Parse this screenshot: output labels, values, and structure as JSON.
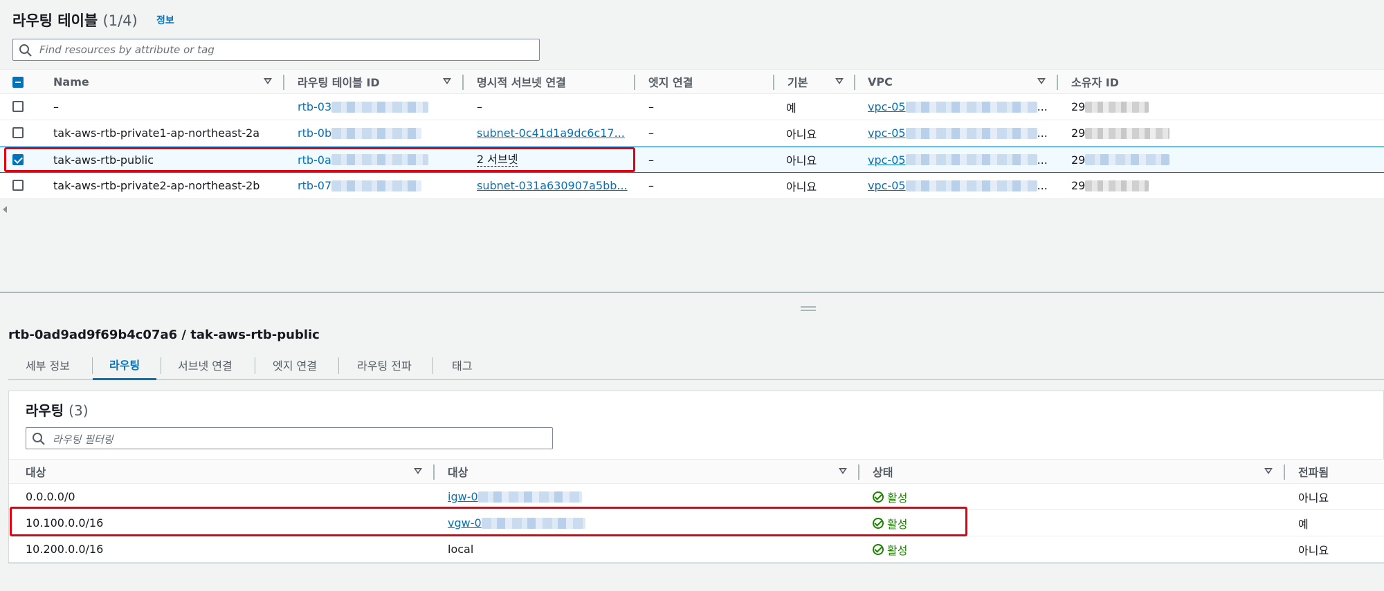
{
  "route_tables": {
    "title": "라우팅 테이블",
    "count": "(1/4)",
    "info_link": "정보",
    "search_placeholder": "Find resources by attribute or tag",
    "columns": [
      "Name",
      "라우팅 테이블 ID",
      "명시적 서브넷 연결",
      "엣지 연결",
      "기본",
      "VPC",
      "소유자 ID"
    ],
    "rows": [
      {
        "name": "–",
        "id_prefix": "rtb-03",
        "subnet": "–",
        "subnet_is_link": false,
        "edge": "–",
        "main": "예",
        "vpc_prefix": "vpc-05",
        "vpc_suffix": "...",
        "owner_prefix": "29",
        "selected": false
      },
      {
        "name": "tak-aws-rtb-private1-ap-northeast-2a",
        "id_prefix": "rtb-0b",
        "subnet": "subnet-0c41d1a9dc6c17...",
        "subnet_is_link": true,
        "edge": "–",
        "main": "아니요",
        "vpc_prefix": "vpc-05",
        "vpc_suffix": "...",
        "owner_prefix": "29",
        "selected": false
      },
      {
        "name": "tak-aws-rtb-public",
        "id_prefix": "rtb-0a",
        "subnet": "2 서브넷",
        "subnet_is_link": false,
        "edge": "–",
        "main": "아니요",
        "vpc_prefix": "vpc-05",
        "vpc_suffix": "...",
        "owner_prefix": "29",
        "selected": true
      },
      {
        "name": "tak-aws-rtb-private2-ap-northeast-2b",
        "id_prefix": "rtb-07",
        "subnet": "subnet-031a630907a5bb...",
        "subnet_is_link": true,
        "edge": "–",
        "main": "아니요",
        "vpc_prefix": "vpc-05",
        "vpc_suffix": "...",
        "owner_prefix": "29",
        "selected": false
      }
    ]
  },
  "detail": {
    "title": "rtb-0ad9ad9f69b4c07a6 / tak-aws-rtb-public",
    "tabs": [
      "세부 정보",
      "라우팅",
      "서브넷 연결",
      "엣지 연결",
      "라우팅 전파",
      "태그"
    ],
    "active_tab": "라우팅"
  },
  "routes": {
    "title": "라우팅",
    "count": "(3)",
    "search_placeholder": "라우팅 필터링",
    "columns": [
      "대상",
      "대상",
      "상태",
      "전파됨"
    ],
    "rows": [
      {
        "destination": "0.0.0.0/0",
        "target": "igw-0",
        "target_is_link": true,
        "target_masked": true,
        "status": "활성",
        "propagated": "아니요"
      },
      {
        "destination": "10.100.0.0/16",
        "target": "vgw-0",
        "target_is_link": true,
        "target_masked": true,
        "status": "활성",
        "propagated": "예"
      },
      {
        "destination": "10.200.0.0/16",
        "target": "local",
        "target_is_link": false,
        "target_masked": false,
        "status": "활성",
        "propagated": "아니요"
      }
    ]
  },
  "colors": {
    "link": "#0073bb",
    "active_status": "#1d8102",
    "highlight_box": "#e0000f",
    "selected_row_bg": "#f1faff"
  }
}
